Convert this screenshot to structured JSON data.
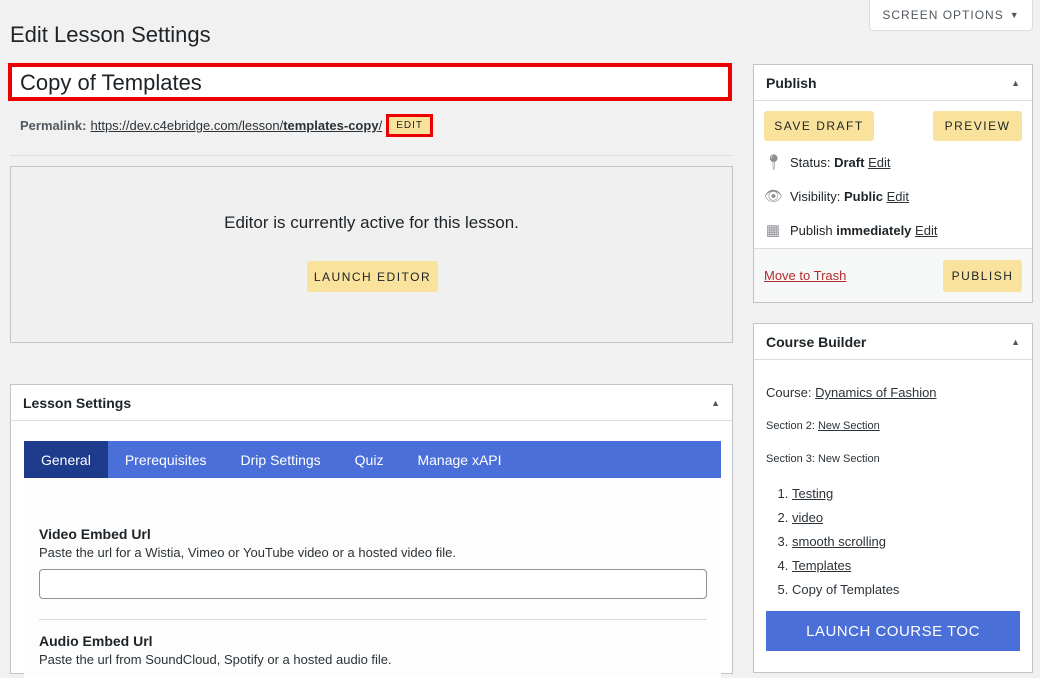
{
  "screen_options": "SCREEN OPTIONS",
  "page_title": "Edit Lesson Settings",
  "post_title": "Copy of Templates",
  "permalink": {
    "label": "Permalink:",
    "url_prefix": "https://dev.c4ebridge.com/lesson/",
    "slug": "templates-copy",
    "url_suffix": "/",
    "edit": "EDIT"
  },
  "editor": {
    "message": "Editor is currently active for this lesson.",
    "launch": "LAUNCH EDITOR"
  },
  "lesson_settings": {
    "title": "Lesson Settings",
    "tabs": [
      "General",
      "Prerequisites",
      "Drip Settings",
      "Quiz",
      "Manage xAPI"
    ],
    "active_tab": "General",
    "fields": [
      {
        "label": "Video Embed Url",
        "desc": "Paste the url for a Wistia, Vimeo or YouTube video or a hosted video file.",
        "value": ""
      },
      {
        "label": "Audio Embed Url",
        "desc": "Paste the url from SoundCloud, Spotify or a hosted audio file."
      }
    ]
  },
  "publish": {
    "title": "Publish",
    "save_draft": "SAVE DRAFT",
    "preview": "PREVIEW",
    "status_label": "Status:",
    "status": "Draft",
    "visibility_label": "Visibility:",
    "visibility": "Public",
    "publish_label": "Publish",
    "publish_when": "immediately",
    "edit": "Edit",
    "trash": "Move to Trash",
    "publish_btn": "PUBLISH"
  },
  "course_builder": {
    "title": "Course Builder",
    "course_label": "Course:",
    "course": "Dynamics of Fashion",
    "section2_label": "Section 2:",
    "section2": "New Section",
    "section3": "Section 3: New Section",
    "lessons": [
      "Testing",
      "video",
      "smooth scrolling",
      "Templates",
      "Copy of Templates"
    ],
    "launch_toc": "LAUNCH COURSE TOC"
  },
  "colors": {
    "accent_blue": "#4a6fd8",
    "active_tab": "#1e3a8a",
    "button_yellow": "#f9e29c",
    "highlight_red": "#ee0000"
  }
}
